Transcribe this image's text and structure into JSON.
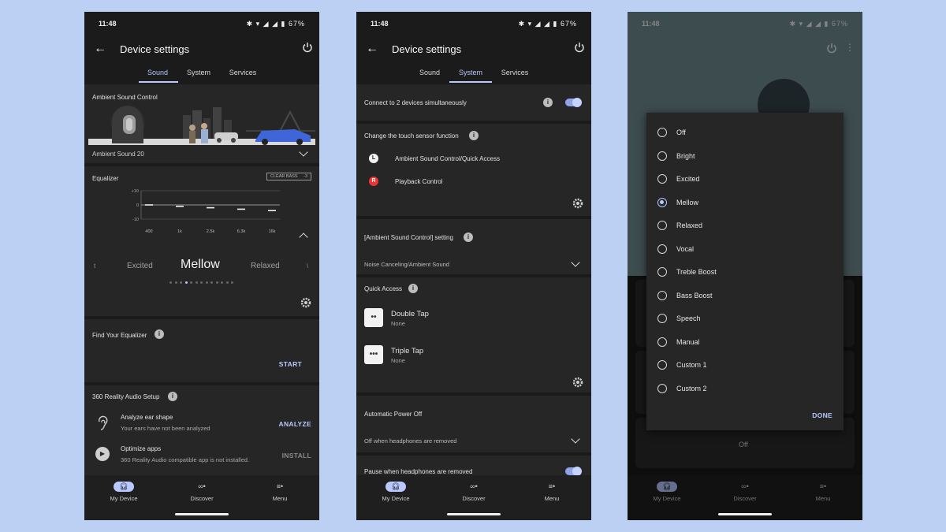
{
  "status": {
    "time": "11:48",
    "battery": "67%"
  },
  "app": {
    "title": "Device settings"
  },
  "tabs": {
    "sound": "Sound",
    "system": "System",
    "services": "Services"
  },
  "nav": {
    "my_device": "My Device",
    "discover": "Discover",
    "menu": "Menu"
  },
  "sound": {
    "ambient_label": "Ambient Sound Control",
    "ambient_value": "Ambient Sound 20",
    "equalizer_label": "Equalizer",
    "clear_bass_label": "CLEAR BASS",
    "clear_bass_value": "-3",
    "eq_axis": [
      "+10",
      "0",
      "-10"
    ],
    "eq_bands": [
      "400",
      "1k",
      "2.5k",
      "6.3k",
      "16k"
    ],
    "eq_levels": [
      0,
      -1,
      -2,
      -3,
      -4
    ],
    "preset_prev_edge": "t",
    "preset_prev": "Excited",
    "preset_current": "Mellow",
    "preset_next": "Relaxed",
    "preset_next_edge": "\\",
    "find_eq_label": "Find Your Equalizer",
    "start_label": "START",
    "reality_label": "360 Reality Audio Setup",
    "analyze_title": "Analyze ear shape",
    "analyze_sub": "Your ears have not been analyzed",
    "analyze_action": "ANALYZE",
    "optimize_title": "Optimize apps",
    "optimize_sub": "360 Reality Audio compatible app is not installed.",
    "install_action": "INSTALL"
  },
  "system": {
    "connect_two": "Connect to 2 devices simultaneously",
    "touch_sensor": "Change the touch sensor function",
    "left_badge": "L",
    "left_function": "Ambient Sound Control/Quick Access",
    "right_badge": "R",
    "right_function": "Playback Control",
    "asc_setting": "[Ambient Sound Control] setting",
    "asc_value": "Noise Canceling/Ambient Sound",
    "quick_access": "Quick Access",
    "double_tap": "Double Tap",
    "double_tap_value": "None",
    "triple_tap": "Triple Tap",
    "triple_tap_value": "None",
    "auto_power_off": "Automatic Power Off",
    "auto_power_value": "Off when headphones are removed",
    "pause_removed": "Pause when headphones are removed"
  },
  "dialog": {
    "options": [
      "Off",
      "Bright",
      "Excited",
      "Mellow",
      "Relaxed",
      "Vocal",
      "Treble Boost",
      "Bass Boost",
      "Speech",
      "Manual",
      "Custom 1",
      "Custom 2"
    ],
    "selected": "Mellow",
    "done": "DONE",
    "background_value": "Off"
  },
  "colors": {
    "accent": "#b9c8ff",
    "surface": "#262626",
    "background": "#1b1b1b",
    "page": "#bcd0f3"
  }
}
